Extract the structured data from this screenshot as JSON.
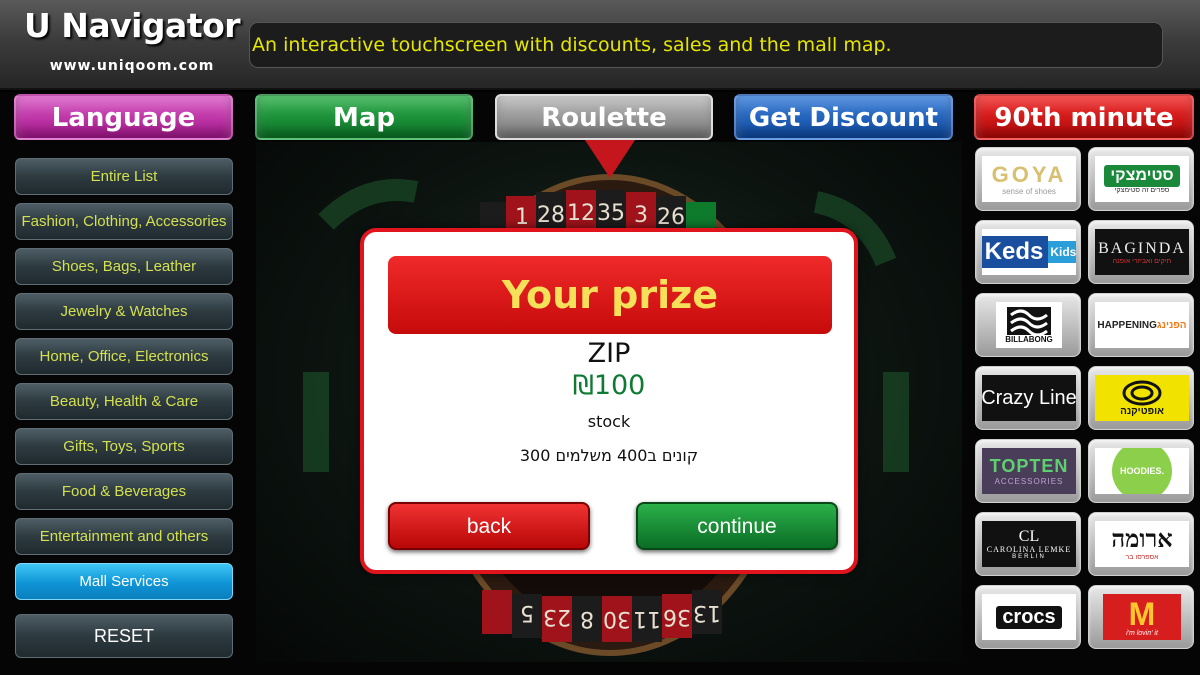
{
  "header": {
    "title": "U Navigator",
    "url": "www.uniqoom.com",
    "ticker": "An interactive touchscreen with discounts, sales and the mall map."
  },
  "top_buttons": {
    "language": "Language",
    "map": "Map",
    "roulette": "Roulette",
    "discount": "Get Discount",
    "ninetieth": "90th minute"
  },
  "sidebar": {
    "items": [
      {
        "label": "Entire List"
      },
      {
        "label": "Fashion, Clothing, Accessories"
      },
      {
        "label": "Shoes, Bags, Leather"
      },
      {
        "label": "Jewelry & Watches"
      },
      {
        "label": "Home, Office, Electronics"
      },
      {
        "label": "Beauty, Health & Care"
      },
      {
        "label": "Gifts, Toys, Sports"
      },
      {
        "label": "Food & Beverages"
      },
      {
        "label": "Entertainment and others"
      },
      {
        "label": "Mall Services"
      }
    ],
    "reset": "RESET"
  },
  "stores": {
    "goya": {
      "name": "GOYA",
      "tagline": "sense of shoes"
    },
    "steimatzky": {
      "name": "סטימצקי",
      "tagline": "ספרים זה סטימצקי"
    },
    "keds": {
      "name": "Keds",
      "tagline": "Kids"
    },
    "baginda": {
      "name": "BAGINDA",
      "tagline": "תיקים ואביזרי אופנה"
    },
    "billabong": {
      "name": "BILLABONG"
    },
    "happening": {
      "name": "HAPPENING",
      "tagline": "הפנינג"
    },
    "crazyline": {
      "name": "Crazy Line"
    },
    "optikana": {
      "name": "אופטיקנה"
    },
    "topten": {
      "name": "TOPTEN",
      "tagline": "ACCESSORIES"
    },
    "hoodies": {
      "name": "HOODIES."
    },
    "carolina": {
      "name": "CAROLINA LEMKE",
      "initials": "CL",
      "city": "BERLIN"
    },
    "aroma": {
      "name": "ארומה",
      "tagline": "אספרסו בר"
    },
    "crocs": {
      "name": "crocs"
    },
    "mcdonalds": {
      "name": "M",
      "tagline": "i'm lovin' it"
    }
  },
  "wheel": {
    "numbers_top": [
      "1",
      "28",
      "12",
      "35",
      "3",
      "26"
    ],
    "numbers_bottom": [
      "5",
      "23",
      "8",
      "30",
      "11",
      "36",
      "13"
    ]
  },
  "dialog": {
    "title": "Your prize",
    "store": "ZIP",
    "amount": "₪100",
    "type": "stock",
    "description": "קונים ב400 משלמים 300",
    "back": "back",
    "continue": "continue"
  },
  "colors": {
    "accent_red": "#e0141c",
    "prize_gold": "#f5e05a",
    "amount_green": "#0f7a33",
    "category_text": "#d3e04f",
    "active_blue": "#0f94d6"
  }
}
